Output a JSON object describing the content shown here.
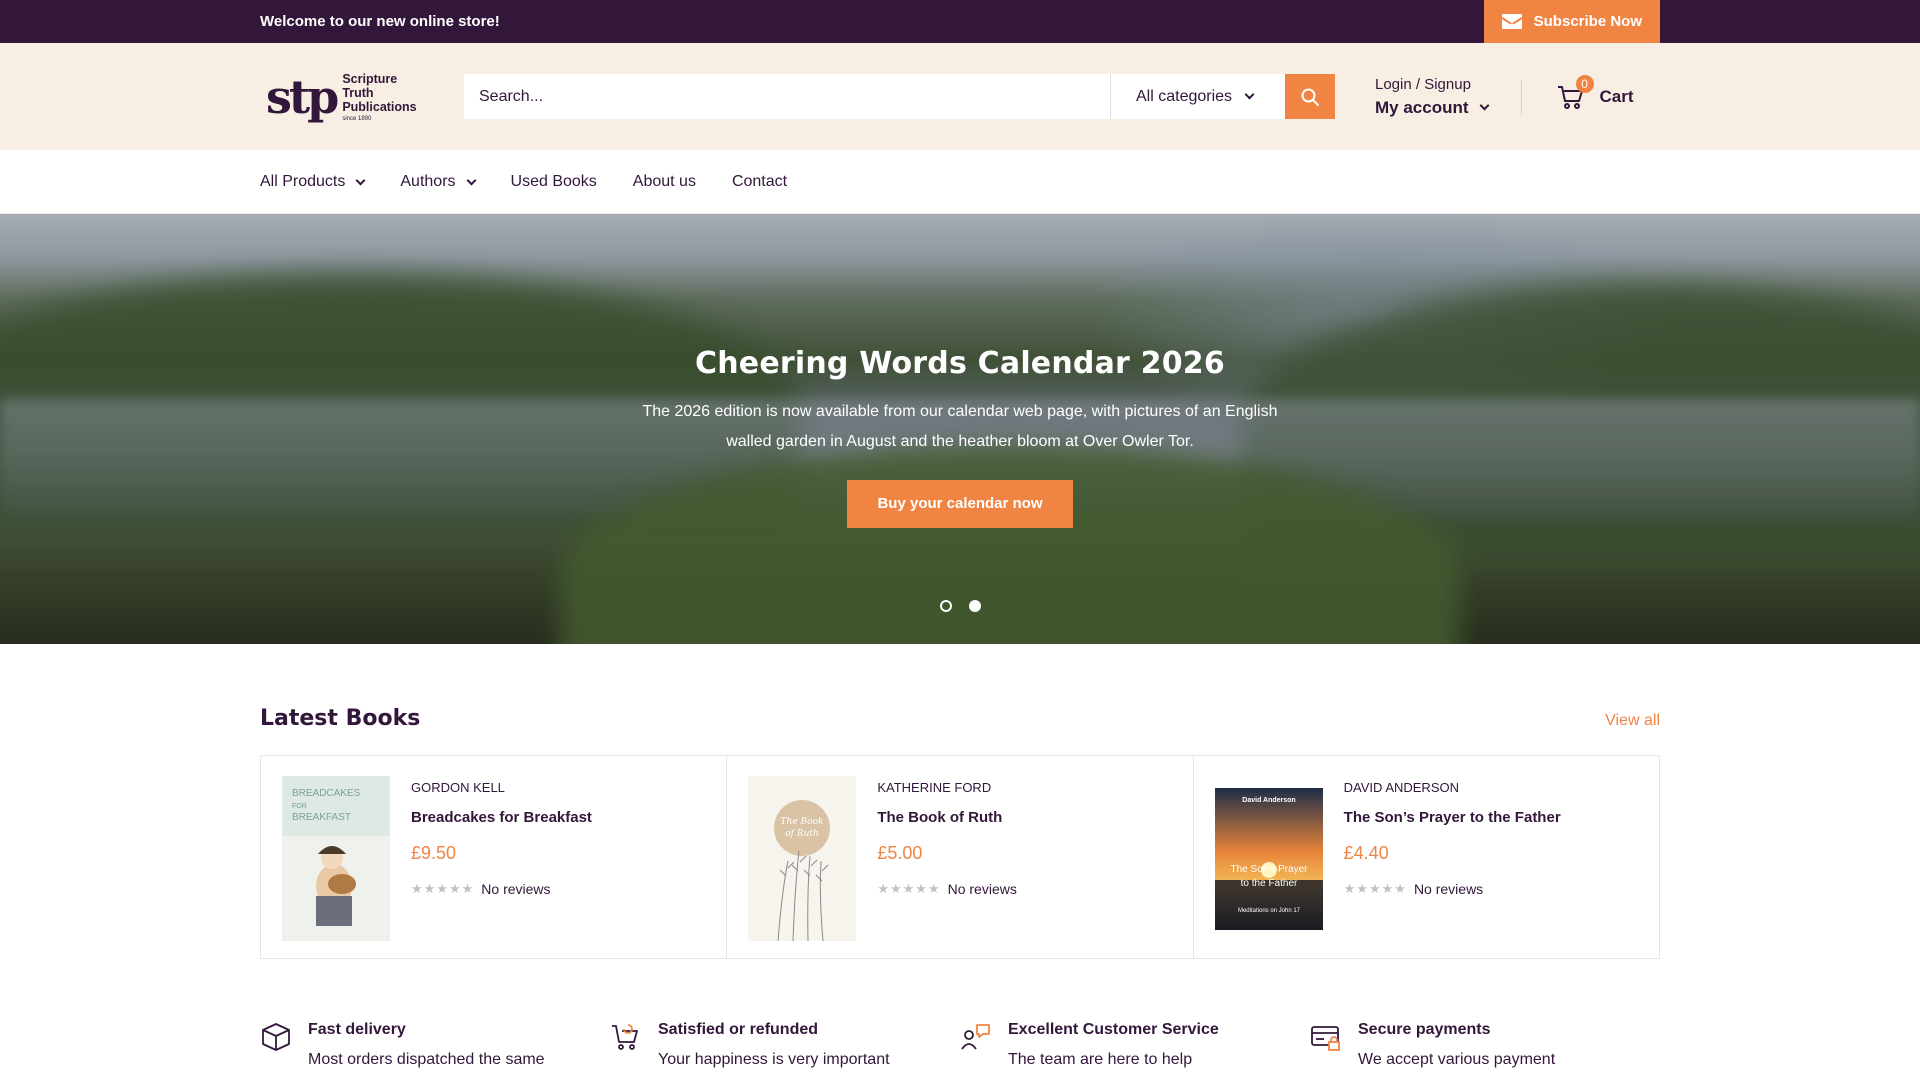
{
  "topbar": {
    "message": "Welcome to our new online store!",
    "subscribe_label": "Subscribe Now"
  },
  "header": {
    "logo": {
      "mark": "stp",
      "line1": "Scripture Truth",
      "line2": "Publications",
      "line3": "since 1890"
    },
    "search_placeholder": "Search...",
    "category_select": "All categories",
    "login_label": "Login / Signup",
    "account_label": "My account",
    "cart_label": "Cart",
    "cart_count": "0"
  },
  "nav": {
    "items": [
      {
        "label": "All Products",
        "dropdown": true
      },
      {
        "label": "Authors",
        "dropdown": true
      },
      {
        "label": "Used Books",
        "dropdown": false
      },
      {
        "label": "About us",
        "dropdown": false
      },
      {
        "label": "Contact",
        "dropdown": false
      }
    ]
  },
  "hero": {
    "title": "Cheering Words Calendar 2026",
    "text": "The 2026 edition is now available from our calendar web page, with pictures of an English walled garden in August and the heather bloom at Over Owler Tor.",
    "button_label": "Buy your calendar now",
    "slide_count": 2,
    "active_slide": 2
  },
  "latest": {
    "title": "Latest Books",
    "view_all": "View all",
    "products": [
      {
        "author": "GORDON KELL",
        "title": "Breadcakes for Breakfast",
        "price": "£9.50",
        "reviews": "No reviews",
        "cover_text": "BREADCAKES FOR BREAKFAST"
      },
      {
        "author": "KATHERINE FORD",
        "title": "The Book of Ruth",
        "price": "£5.00",
        "reviews": "No reviews",
        "cover_text": "The Book of Ruth"
      },
      {
        "author": "DAVID ANDERSON",
        "title": "The Son’s Prayer to the Father",
        "price": "£4.40",
        "reviews": "No reviews",
        "cover_text": "The Son's Prayer to the Father"
      }
    ]
  },
  "features": [
    {
      "icon": "box-icon",
      "title": "Fast delivery",
      "text": "Most orders dispatched the same"
    },
    {
      "icon": "cart-return-icon",
      "title": "Satisfied or refunded",
      "text": "Your happiness is very important"
    },
    {
      "icon": "support-icon",
      "title": "Excellent Customer Service",
      "text": "The team are here to help"
    },
    {
      "icon": "secure-payment-icon",
      "title": "Secure payments",
      "text": "We accept various payment"
    }
  ],
  "colors": {
    "topbar_bg": "#33173a",
    "accent": "#f08443",
    "header_bg": "#f7efe3",
    "text": "#33173a"
  }
}
